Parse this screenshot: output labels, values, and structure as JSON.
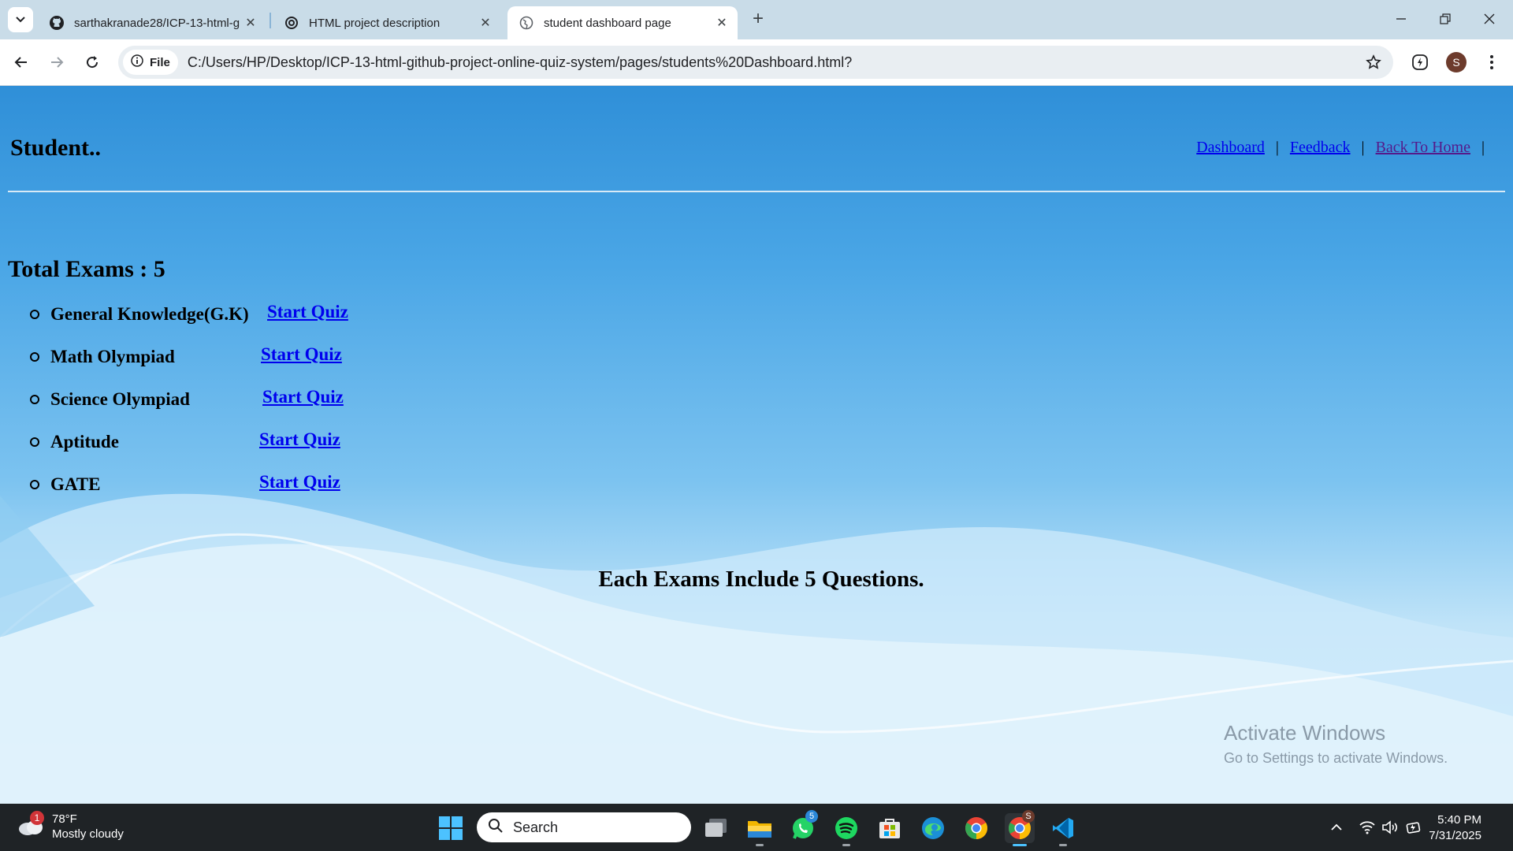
{
  "browser": {
    "tabs": [
      {
        "title": "sarthakranade28/ICP-13-html-g",
        "icon": "github-icon"
      },
      {
        "title": "HTML project description",
        "icon": "chatgpt-icon"
      },
      {
        "title": "student dashboard page",
        "icon": "globe-icon"
      }
    ],
    "file_label": "File",
    "url": "C:/Users/HP/Desktop/ICP-13-html-github-project-online-quiz-system/pages/students%20Dashboard.html?",
    "profile_initial": "S"
  },
  "page": {
    "brand": "Student..",
    "nav": [
      {
        "label": "Dashboard",
        "color": "#0000ee"
      },
      {
        "label": "Feedback",
        "color": "#0000ee"
      },
      {
        "label": "Back To Home",
        "color": "#551a8b"
      }
    ],
    "nav_separator": "|",
    "total_exams": "Total Exams : 5",
    "exams": [
      {
        "name": "General Knowledge(G.K)",
        "action": "Start Quiz"
      },
      {
        "name": "Math Olympiad",
        "action": "Start Quiz"
      },
      {
        "name": "Science Olympiad",
        "action": "Start Quiz"
      },
      {
        "name": "Aptitude",
        "action": "Start Quiz"
      },
      {
        "name": "GATE",
        "action": "Start Quiz"
      }
    ],
    "note": "Each Exams Include 5 Questions."
  },
  "watermark": {
    "title": "Activate Windows",
    "subtitle": "Go to Settings to activate Windows."
  },
  "taskbar": {
    "weather": {
      "temp": "78°F",
      "condition": "Mostly cloudy",
      "badge": "1"
    },
    "search_placeholder": "Search",
    "whatsapp_badge": "5",
    "chrome_profile_badge": "S",
    "time": "5:40 PM",
    "date": "7/31/2025"
  }
}
